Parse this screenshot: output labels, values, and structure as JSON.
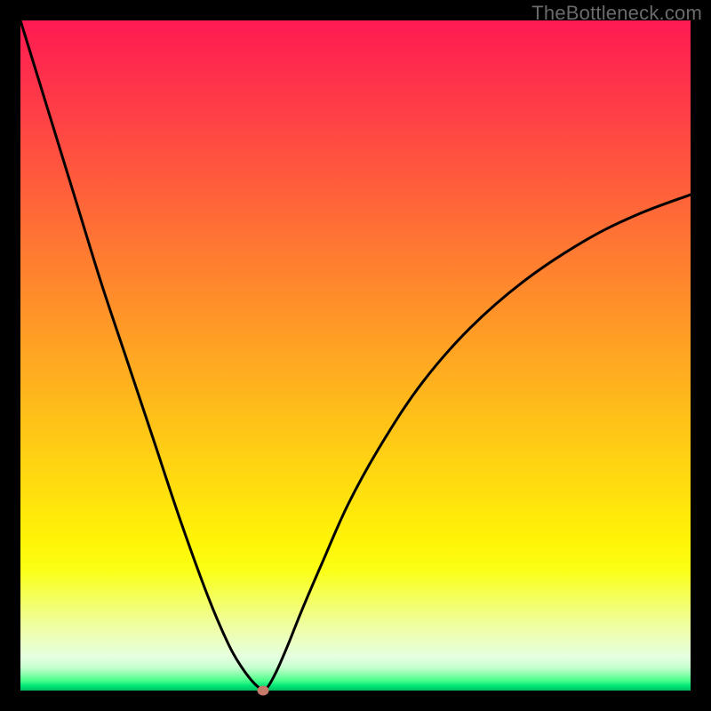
{
  "watermark": "TheBottleneck.com",
  "chart_data": {
    "type": "line",
    "title": "",
    "xlabel": "",
    "ylabel": "",
    "xlim": [
      0,
      1
    ],
    "ylim": [
      0,
      1
    ],
    "grid": false,
    "legend": false,
    "series": [
      {
        "name": "bottleneck-curve",
        "x": [
          0.0,
          0.04,
          0.08,
          0.12,
          0.16,
          0.2,
          0.24,
          0.28,
          0.31,
          0.33,
          0.345,
          0.356,
          0.362,
          0.368,
          0.375,
          0.385,
          0.4,
          0.42,
          0.45,
          0.49,
          0.54,
          0.6,
          0.67,
          0.75,
          0.84,
          0.92,
          1.0
        ],
        "y": [
          1.0,
          0.87,
          0.74,
          0.61,
          0.49,
          0.37,
          0.25,
          0.14,
          0.07,
          0.035,
          0.015,
          0.004,
          0.0,
          0.004,
          0.015,
          0.035,
          0.07,
          0.12,
          0.19,
          0.28,
          0.37,
          0.46,
          0.54,
          0.61,
          0.67,
          0.71,
          0.74
        ]
      }
    ],
    "marker": {
      "x": 0.362,
      "y": 0.0
    },
    "background_gradient": {
      "top": "#ff1a52",
      "mid": "#ffd312",
      "bottom": "#00c060"
    }
  }
}
